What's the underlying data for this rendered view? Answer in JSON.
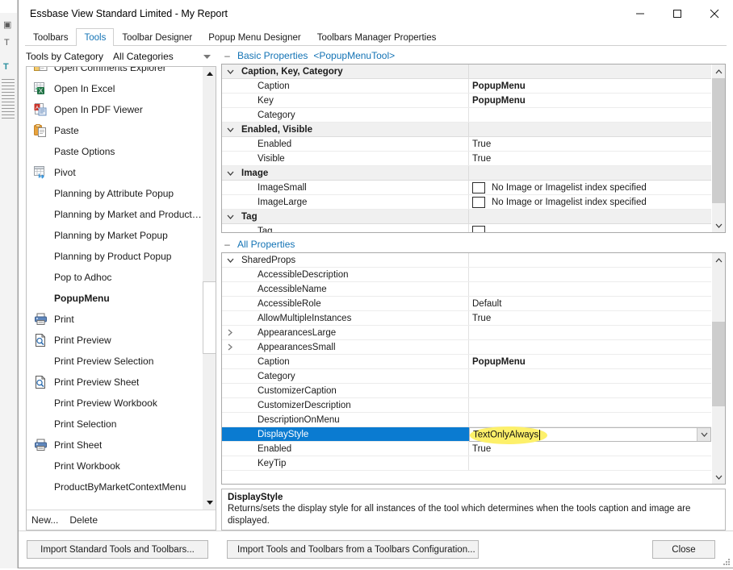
{
  "window": {
    "title": "Essbase View Standard Limited - My Report",
    "controls": {
      "minimize": "minimize",
      "maximize": "maximize",
      "close": "close"
    }
  },
  "tabs": [
    {
      "label": "Toolbars",
      "active": false
    },
    {
      "label": "Tools",
      "active": true
    },
    {
      "label": "Toolbar Designer",
      "active": false
    },
    {
      "label": "Popup Menu Designer",
      "active": false
    },
    {
      "label": "Toolbars Manager Properties",
      "active": false
    }
  ],
  "left_pane": {
    "category_label": "Tools by Category",
    "category_value": "All Categories",
    "tools": [
      {
        "label": "Open Comments Explorer",
        "icon": "comments-explorer-icon",
        "bold": false,
        "clipped": true
      },
      {
        "label": "Open In Excel",
        "icon": "excel-icon",
        "bold": false
      },
      {
        "label": "Open In PDF Viewer",
        "icon": "pdf-icon",
        "bold": false
      },
      {
        "label": "Paste",
        "icon": "paste-icon",
        "bold": false
      },
      {
        "label": "Paste Options",
        "icon": "",
        "bold": false
      },
      {
        "label": "Pivot",
        "icon": "pivot-icon",
        "bold": false
      },
      {
        "label": "Planning by Attribute Popup",
        "icon": "",
        "bold": false
      },
      {
        "label": "Planning by Market and Product P...",
        "icon": "",
        "bold": false
      },
      {
        "label": "Planning by Market Popup",
        "icon": "",
        "bold": false
      },
      {
        "label": "Planning by Product Popup",
        "icon": "",
        "bold": false
      },
      {
        "label": "Pop to Adhoc",
        "icon": "",
        "bold": false
      },
      {
        "label": "PopupMenu",
        "icon": "",
        "bold": true
      },
      {
        "label": "Print",
        "icon": "print-icon",
        "bold": false
      },
      {
        "label": "Print Preview",
        "icon": "print-preview-icon",
        "bold": false
      },
      {
        "label": "Print Preview Selection",
        "icon": "",
        "bold": false
      },
      {
        "label": "Print Preview Sheet",
        "icon": "print-preview-icon",
        "bold": false
      },
      {
        "label": "Print Preview Workbook",
        "icon": "",
        "bold": false
      },
      {
        "label": "Print Selection",
        "icon": "",
        "bold": false
      },
      {
        "label": "Print Sheet",
        "icon": "print-icon",
        "bold": false
      },
      {
        "label": "Print Workbook",
        "icon": "",
        "bold": false
      },
      {
        "label": "ProductByMarketContextMenu",
        "icon": "",
        "bold": false
      }
    ],
    "footer": {
      "new_label": "New...",
      "delete_label": "Delete"
    }
  },
  "basic_properties": {
    "header_main": "Basic Properties",
    "header_sub": "<PopupMenuTool>",
    "rows": [
      {
        "name": "Caption, Key, Category",
        "value": "",
        "type": "category"
      },
      {
        "name": "Caption",
        "value": "PopupMenu",
        "type": "prop",
        "bold_value": true
      },
      {
        "name": "Key",
        "value": "PopupMenu",
        "type": "prop",
        "bold_value": true
      },
      {
        "name": "Category",
        "value": "",
        "type": "prop"
      },
      {
        "name": "Enabled, Visible",
        "value": "",
        "type": "category"
      },
      {
        "name": "Enabled",
        "value": "True",
        "type": "prop"
      },
      {
        "name": "Visible",
        "value": "True",
        "type": "prop"
      },
      {
        "name": "Image",
        "value": "",
        "type": "category"
      },
      {
        "name": "ImageSmall",
        "value": "No Image or Imagelist index specified",
        "type": "prop",
        "swatch": true
      },
      {
        "name": "ImageLarge",
        "value": "No Image or Imagelist index specified",
        "type": "prop",
        "swatch": true
      },
      {
        "name": "Tag",
        "value": "",
        "type": "category"
      },
      {
        "name": "Tag",
        "value": "",
        "type": "prop",
        "swatch": true
      }
    ]
  },
  "all_properties": {
    "header_main": "All Properties",
    "rows": [
      {
        "name": "SharedProps",
        "value": "",
        "type": "category-plain",
        "expander": "chevron-down"
      },
      {
        "name": "AccessibleDescription",
        "value": "",
        "type": "prop"
      },
      {
        "name": "AccessibleName",
        "value": "",
        "type": "prop"
      },
      {
        "name": "AccessibleRole",
        "value": "Default",
        "type": "prop"
      },
      {
        "name": "AllowMultipleInstances",
        "value": "True",
        "type": "prop"
      },
      {
        "name": "AppearancesLarge",
        "value": "",
        "type": "prop",
        "expander": "chevron-right"
      },
      {
        "name": "AppearancesSmall",
        "value": "",
        "type": "prop",
        "expander": "chevron-right"
      },
      {
        "name": "Caption",
        "value": "PopupMenu",
        "type": "prop",
        "bold_value": true
      },
      {
        "name": "Category",
        "value": "",
        "type": "prop"
      },
      {
        "name": "CustomizerCaption",
        "value": "",
        "type": "prop"
      },
      {
        "name": "CustomizerDescription",
        "value": "",
        "type": "prop"
      },
      {
        "name": "DescriptionOnMenu",
        "value": "",
        "type": "prop"
      },
      {
        "name": "DisplayStyle",
        "value": "TextOnlyAlways",
        "type": "prop",
        "selected": true,
        "editing": true,
        "highlighted": true
      },
      {
        "name": "Enabled",
        "value": "True",
        "type": "prop"
      },
      {
        "name": "KeyTip",
        "value": "",
        "type": "prop",
        "clipped": true
      }
    ]
  },
  "description": {
    "title": "DisplayStyle",
    "text": "Returns/sets the display style for all instances of the tool which determines when the tools caption and image are displayed."
  },
  "footer": {
    "import_standard": "Import Standard Tools and Toolbars...",
    "import_config": "Import Tools and Toolbars from a Toolbars Configuration...",
    "close": "Close"
  },
  "colors": {
    "selection_blue": "#0a7bd1",
    "link_blue": "#1373b5",
    "highlight_yellow": "#fdf06a",
    "category_gray": "#f0f0f0"
  }
}
